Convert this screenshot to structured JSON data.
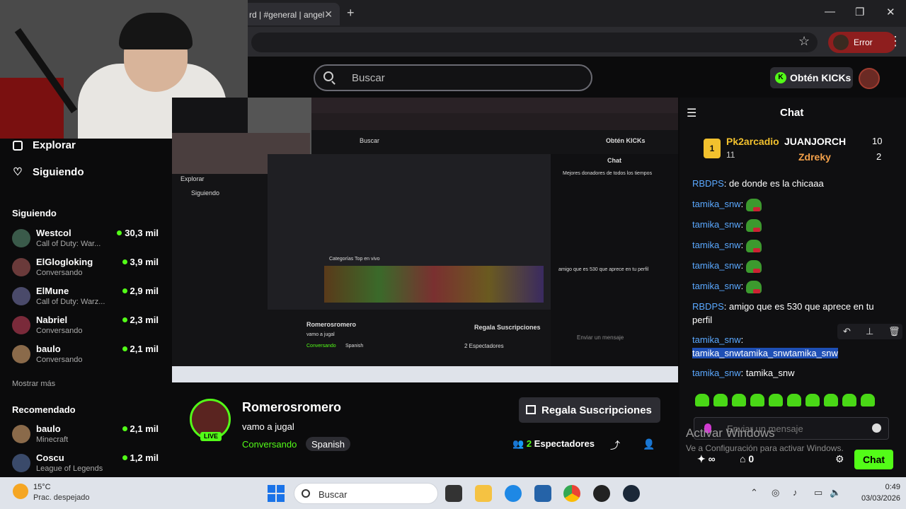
{
  "browser": {
    "tab_title": "rd | #general | angel",
    "tab_close": "✕",
    "new_tab": "+",
    "profile_label": "Error",
    "minimize": "—",
    "maximize": "❐",
    "close": "✕"
  },
  "header": {
    "search_placeholder": "Buscar",
    "kicks_label": "Obtén KICKs"
  },
  "sidebar": {
    "explore": "Explorar",
    "following": "Siguiendo",
    "following_section": "Siguiendo",
    "channels": [
      {
        "name": "Westcol",
        "sub": "Call of Duty: War...",
        "viewers": "30,3 mil"
      },
      {
        "name": "ElGlogloking",
        "sub": "Conversando",
        "viewers": "3,9 mil"
      },
      {
        "name": "ElMune",
        "sub": "Call of Duty: Warz...",
        "viewers": "2,9 mil"
      },
      {
        "name": "Nabriel",
        "sub": "Conversando",
        "viewers": "2,3 mil"
      },
      {
        "name": "baulo",
        "sub": "Conversando",
        "viewers": "2,1 mil"
      }
    ],
    "show_more": "Mostrar más",
    "recommended_section": "Recomendado",
    "recommended": [
      {
        "name": "baulo",
        "sub": "Minecraft",
        "viewers": "2,1 mil"
      },
      {
        "name": "Coscu",
        "sub": "League of Legends",
        "viewers": "1,2 mil"
      }
    ]
  },
  "nested": {
    "search": "Buscar",
    "kicks": "Obtén KICKs",
    "chat": "Chat",
    "top_donors": "Mejores donadores de todos los tiempos",
    "streamer": "Romerosromero",
    "title": "vamo a jugal",
    "gift": "Regala Suscripciones",
    "viewers": "2 Espectadores",
    "explore": "Explorar",
    "following": "Siguiendo",
    "input": "Enviar un mensaje",
    "msg_rbdps": "amigo que es 530 que aprece en tu perfil",
    "category": "Conversando",
    "tag": "Spanish",
    "top_categories": "Categorías Top en vivo"
  },
  "stream": {
    "live_badge": "LIVE",
    "streamer": "Romerosromero",
    "title": "vamo a jugal",
    "category": "Conversando",
    "tag": "Spanish",
    "gift_label": "Regala Suscripciones",
    "viewer_count": "2",
    "viewer_label": "Espectadores"
  },
  "chat": {
    "title": "Chat",
    "donors": [
      {
        "rank": "1",
        "name": "Pk2arcadio",
        "amount": "11"
      },
      {
        "rank": "",
        "name": "JUANJORCH",
        "amount": "10"
      },
      {
        "rank": "",
        "name": "Zdreky",
        "amount": "2"
      }
    ],
    "messages": [
      {
        "user": "RBDPS",
        "text": "de donde es la chicaaa"
      },
      {
        "user": "tamika_snw",
        "text": ""
      },
      {
        "user": "tamika_snw",
        "text": ""
      },
      {
        "user": "tamika_snw",
        "text": ""
      },
      {
        "user": "tamika_snw",
        "text": ""
      },
      {
        "user": "tamika_snw",
        "text": ""
      },
      {
        "user": "RBDPS",
        "text": "amigo que es 530 que aprece en tu perfil"
      },
      {
        "user": "tamika_snw",
        "text": "tamika_snwtamika_snwtamika_snw"
      },
      {
        "user": "tamika_snw",
        "text": "tamika_snw"
      }
    ],
    "input_placeholder": "Enviar un mensaje",
    "send_label": "Chat",
    "points": "∞",
    "store_count": "0",
    "watermark_title": "Activar Windows",
    "watermark_sub": "Ve a Configuración para activar Windows."
  },
  "taskbar": {
    "temp": "15°C",
    "condition": "Prac. despejado",
    "search": "Buscar",
    "time": "0:49",
    "date": "03/03/2026"
  },
  "colors": {
    "accent": "#53fc18",
    "username": "#5aa8ff",
    "error": "#8e1e1e"
  }
}
